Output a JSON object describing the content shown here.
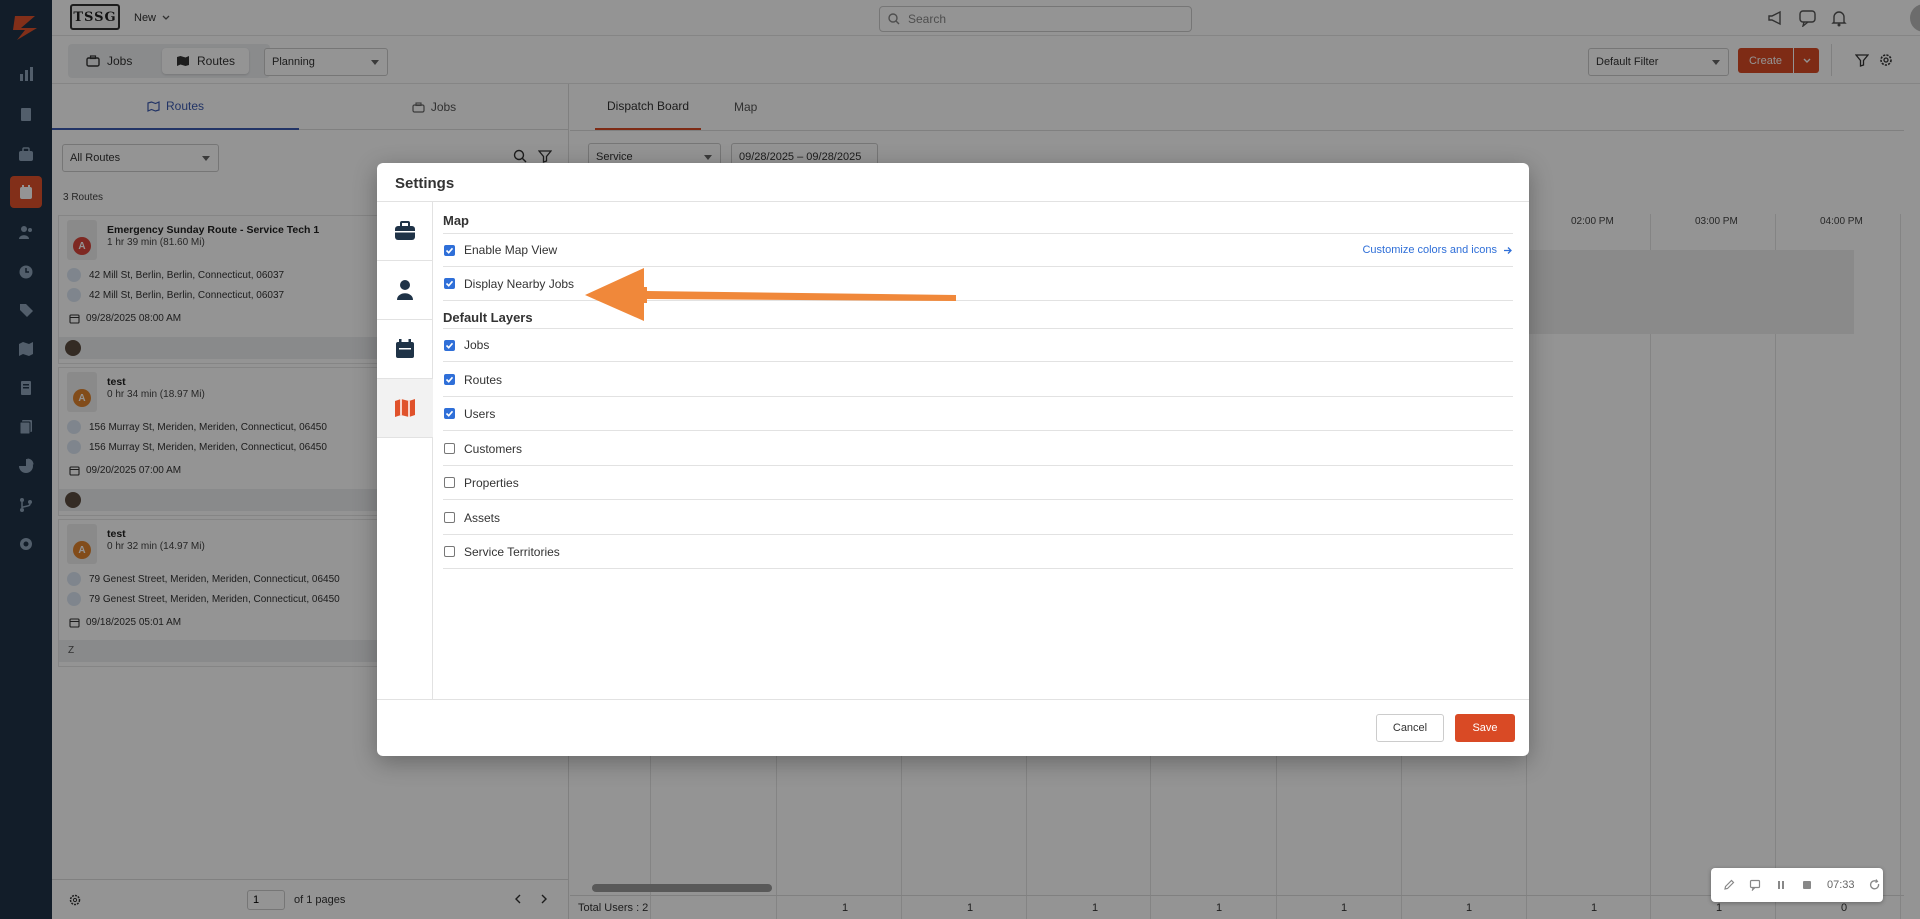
{
  "app": {
    "brand": "TSSG",
    "new_label": "New",
    "search_placeholder": "Search"
  },
  "toolbar": {
    "seg_jobs": "Jobs",
    "seg_routes": "Routes",
    "planning_select": "Planning",
    "default_filter": "Default Filter",
    "create_label": "Create"
  },
  "left": {
    "tab_routes": "Routes",
    "tab_jobs": "Jobs",
    "filter_select": "All Routes",
    "count_label": "3 Routes",
    "routes": [
      {
        "pin_letter": "A",
        "pin_color": "#d9463b",
        "title": "Emergency Sunday Route - Service Tech 1",
        "sub": "1 hr 39 min (81.60 Mi)",
        "addr_start": "42 Mill St, Berlin, Berlin, Connecticut, 06037",
        "addr_end": "42 Mill St, Berlin, Berlin, Connecticut, 06037",
        "date": "09/28/2025 08:00 AM",
        "user": ""
      },
      {
        "pin_letter": "A",
        "pin_color": "#e0832d",
        "title": "test",
        "sub": "0 hr 34 min (18.97 Mi)",
        "addr_start": "156 Murray St, Meriden, Meriden, Connecticut, 06450",
        "addr_end": "156 Murray St, Meriden, Meriden, Connecticut, 06450",
        "date": "09/20/2025 07:00 AM",
        "user": ""
      },
      {
        "pin_letter": "A",
        "pin_color": "#e0832d",
        "title": "test",
        "sub": "0 hr 32 min (14.97 Mi)",
        "addr_start": "79 Genest Street, Meriden, Meriden, Connecticut, 06450",
        "addr_end": "79 Genest Street, Meriden, Meriden, Connecticut, 06450",
        "date": "09/18/2025 05:01 AM",
        "user": "Z"
      }
    ],
    "page_input": "1",
    "page_label": "of 1 pages"
  },
  "board": {
    "tab_dispatch": "Dispatch Board",
    "tab_map": "Map",
    "service_select": "Service",
    "date_range": "09/28/2025 – 09/28/2025",
    "times": [
      "02:00 PM",
      "03:00 PM",
      "04:00 PM"
    ],
    "total_users": "Total Users : 2",
    "footer_counts": [
      "1",
      "1",
      "1",
      "1",
      "1",
      "1",
      "1",
      "1",
      "0"
    ]
  },
  "modal": {
    "title": "Settings",
    "map_section": "Map",
    "enable_map_view": "Enable Map View",
    "customize_link": "Customize colors and icons",
    "display_nearby_jobs": "Display Nearby Jobs",
    "default_layers_section": "Default Layers",
    "layers": [
      {
        "label": "Jobs",
        "checked": true
      },
      {
        "label": "Routes",
        "checked": true
      },
      {
        "label": "Users",
        "checked": true
      },
      {
        "label": "Customers",
        "checked": false
      },
      {
        "label": "Properties",
        "checked": false
      },
      {
        "label": "Assets",
        "checked": false
      },
      {
        "label": "Service Territories",
        "checked": false
      }
    ],
    "cancel_label": "Cancel",
    "save_label": "Save"
  },
  "recorder": {
    "time": "07:33"
  },
  "colors": {
    "accent": "#d94a25",
    "sidebar": "#1f3347",
    "link": "#2f6fd8",
    "annotation_arrow": "#f0883a"
  }
}
